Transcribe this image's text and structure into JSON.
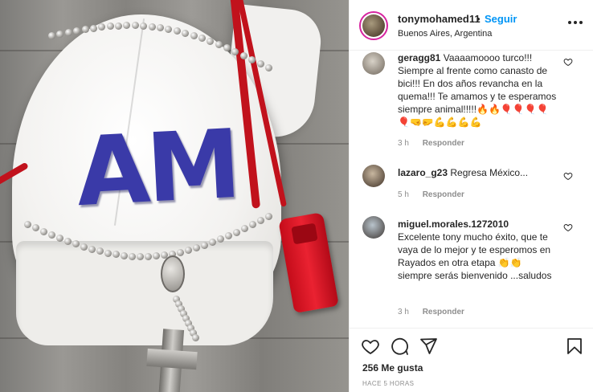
{
  "post": {
    "owner": "tonymohamed11",
    "separator": "•",
    "follow_label": "Seguir",
    "location": "Buenos Aires, Argentina",
    "more_icon": "more-horizontal-icon",
    "photo": {
      "logo_text": "AM"
    }
  },
  "comments": [
    {
      "username": "geragg81",
      "text": "Vaaaamoooo turco!!! Siempre al frente como canasto de bici!!! En dos años revancha en la quema!!! Te amamos y te esperamos siempre animal!!!!!🔥🔥🎈🎈🎈🎈🎈🤜🤛💪💪💪💪",
      "time": "3 h",
      "reply_label": "Responder"
    },
    {
      "username": "lazaro_g23",
      "text": "Regresa México...",
      "time": "5 h",
      "reply_label": "Responder"
    },
    {
      "username": "miguel.morales.1272010",
      "text": "Excelente tony mucho éxito, que te vaya de lo mejor y te esperomos en Rayados en otra etapa 👏👏 siempre serás bienvenido ...saludos",
      "time": "3 h",
      "reply_label": "Responder"
    }
  ],
  "actions": {
    "likes": "256 Me gusta",
    "timestamp": "HACE 5 HORAS",
    "icons": [
      "heart-icon",
      "comment-icon",
      "share-icon",
      "bookmark-icon"
    ]
  },
  "colors": {
    "link_blue": "#0095f6",
    "text": "#262626",
    "muted": "#8e8e8e",
    "logo_blue": "#3a3aa8",
    "whistle_red": "#e0202e"
  }
}
